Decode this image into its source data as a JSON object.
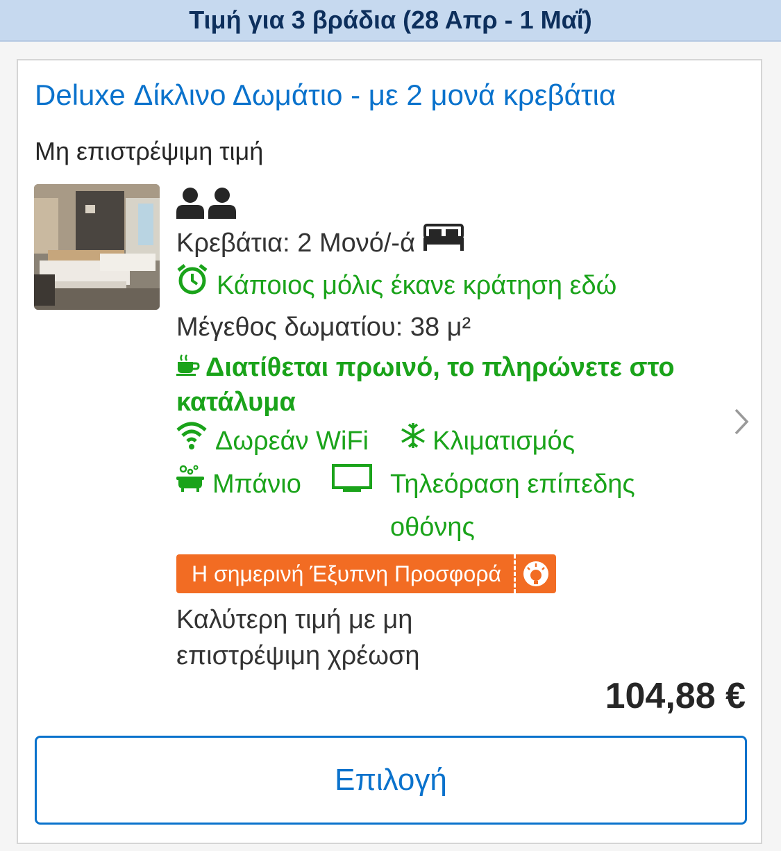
{
  "header": {
    "price_for_nights": "Τιμή για 3 βράδια (28 Απρ - 1 Μαΐ)"
  },
  "room": {
    "title": "Deluxe Δίκλινο Δωμάτιο - με 2 μονά κρεβάτια",
    "policy": "Μη επιστρέψιμη τιμή",
    "occupancy_icon": "two-persons-icon",
    "beds": "Κρεβάτια: 2 Μονό/-ά",
    "recent_booking": "Κάποιος μόλις έκανε κράτηση εδώ",
    "room_size": "Μέγεθος δωματίου: 38 μ²",
    "breakfast": "Διατίθεται πρωινό, το πληρώνετε στο κατάλυμα",
    "facilities": [
      {
        "icon": "wifi-icon",
        "label": "Δωρεάν WiFi"
      },
      {
        "icon": "snowflake-icon",
        "label": "Κλιματισμός"
      },
      {
        "icon": "bathtub-icon",
        "label": "Μπάνιο"
      },
      {
        "icon": "tv-icon",
        "label": "Τηλεόραση επίπεδης οθόνης"
      }
    ],
    "deal_badge": "Η σημερινή Έξυπνη Προσφορά",
    "best_price_note": "Καλύτερη τιμή με μη επιστρέψιμη χρέωση",
    "price": "104,88 €",
    "select_button": "Επιλογή"
  },
  "colors": {
    "link_blue": "#0a72cc",
    "green": "#1aa31a",
    "deal_orange": "#f26c23",
    "header_bg": "#c6d9ef"
  }
}
